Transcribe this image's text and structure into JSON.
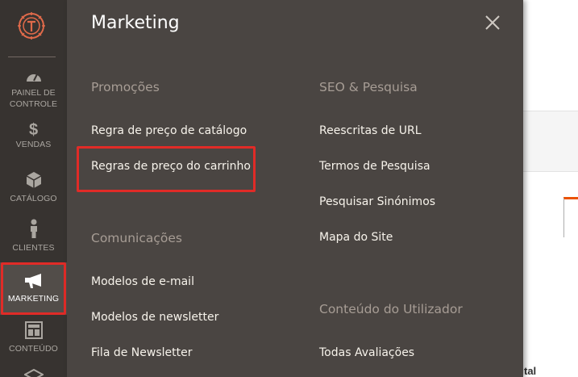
{
  "sidebar": {
    "logo_icon": "magento-logo-icon",
    "items": [
      {
        "label": "Painel de Controle",
        "icon": "dashboard-icon"
      },
      {
        "label": "Vendas",
        "icon": "dollar-icon"
      },
      {
        "label": "Catálogo",
        "icon": "box-icon"
      },
      {
        "label": "Clientes",
        "icon": "person-icon"
      },
      {
        "label": "Marketing",
        "icon": "megaphone-icon",
        "active": true
      },
      {
        "label": "Conteúdo",
        "icon": "layout-icon"
      },
      {
        "label": "",
        "icon": "stores-icon"
      }
    ]
  },
  "flyout": {
    "title": "Marketing",
    "close_icon": "close-icon",
    "sections": {
      "promocoes": {
        "title": "Promoções",
        "links": [
          "Regra de preço de catálogo",
          "Regras de preço do carrinho"
        ]
      },
      "comunicacoes": {
        "title": "Comunicações",
        "links": [
          "Modelos de e-mail",
          "Modelos de newsletter",
          "Fila de Newsletter"
        ]
      },
      "seo": {
        "title": "SEO & Pesquisa",
        "links": [
          "Reescritas de URL",
          "Termos de Pesquisa",
          "Pesquisar Sinónimos",
          "Mapa do Site"
        ]
      },
      "conteudo": {
        "title": "Conteúdo do Utilizador",
        "links": [
          "Todas Avaliações"
        ]
      }
    }
  },
  "background_page": {
    "fragment_text": "tal"
  },
  "colors": {
    "sidebar_bg": "#373330",
    "flyout_bg": "#4a4542",
    "highlight": "#e02b27",
    "accent": "#eb5202"
  }
}
